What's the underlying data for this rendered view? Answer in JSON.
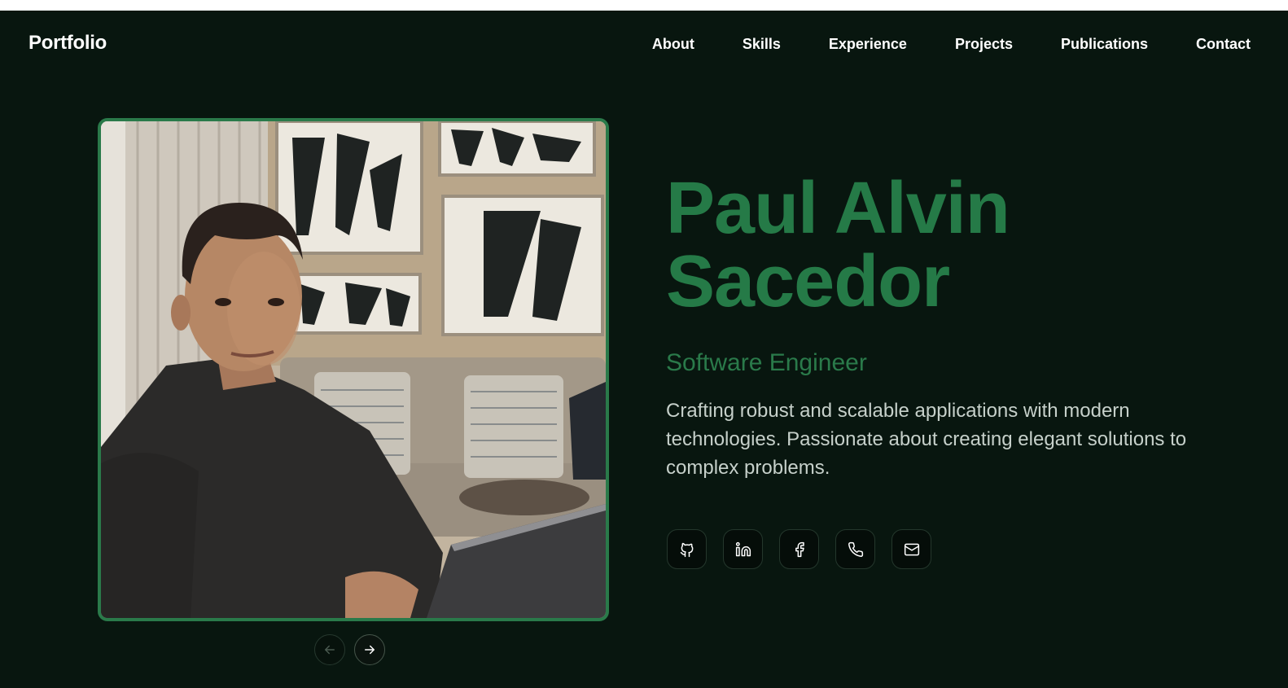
{
  "nav": {
    "brand": "Portfolio",
    "items": [
      "About",
      "Skills",
      "Experience",
      "Projects",
      "Publications",
      "Contact"
    ]
  },
  "hero": {
    "name_line1": "Paul Alvin",
    "name_line2": "Sacedor",
    "role": "Software Engineer",
    "description": "Crafting robust and scalable applications with modern technologies. Passionate about creating elegant solutions to complex problems."
  },
  "socials": [
    {
      "icon": "github-icon"
    },
    {
      "icon": "linkedin-icon"
    },
    {
      "icon": "facebook-icon"
    },
    {
      "icon": "phone-icon"
    },
    {
      "icon": "mail-icon"
    }
  ],
  "carousel": {
    "prev_icon": "arrow-left-icon",
    "next_icon": "arrow-right-icon"
  },
  "colors": {
    "background": "#08160f",
    "accent": "#257a47",
    "text": "#ffffff",
    "muted": "#c6d0ca"
  }
}
